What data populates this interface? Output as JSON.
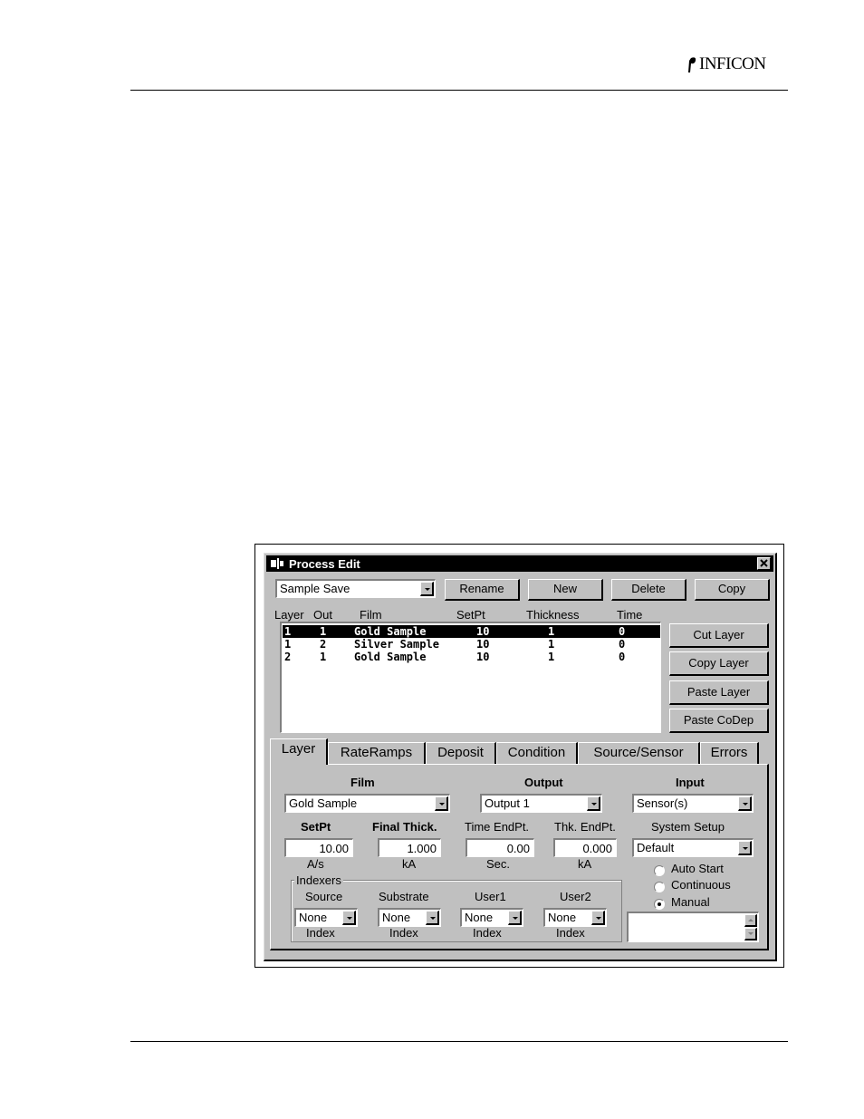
{
  "brand": {
    "logo_text": "INFICON"
  },
  "window": {
    "title": "Process Edit",
    "process_combo": {
      "value": "Sample Save"
    },
    "toolbar": {
      "rename_label": "Rename",
      "new_label": "New",
      "delete_label": "Delete",
      "copy_label": "Copy"
    },
    "list": {
      "columns": [
        "Layer",
        "Out",
        "Film",
        "SetPt",
        "Thickness",
        "Time"
      ],
      "rows": [
        {
          "layer": "1",
          "out": "1",
          "film": "Gold Sample",
          "setpt": "10",
          "thickness": "1",
          "time": "0",
          "selected": true
        },
        {
          "layer": "1",
          "out": "2",
          "film": "Silver Sample",
          "setpt": "10",
          "thickness": "1",
          "time": "0",
          "selected": false
        },
        {
          "layer": "2",
          "out": "1",
          "film": "Gold Sample",
          "setpt": "10",
          "thickness": "1",
          "time": "0",
          "selected": false
        }
      ]
    },
    "side_buttons": {
      "cut": "Cut Layer",
      "copy": "Copy Layer",
      "paste": "Paste Layer",
      "paste_codep": "Paste CoDep"
    },
    "tabs": [
      "Layer",
      "RateRamps",
      "Deposit",
      "Condition",
      "Source/Sensor",
      "Errors"
    ],
    "active_tab": "Layer",
    "layer_tab": {
      "film_label": "Film",
      "film_value": "Gold Sample",
      "output_label": "Output",
      "output_value": "Output 1",
      "input_label": "Input",
      "input_value": "Sensor(s)",
      "setpt_label": "SetPt",
      "setpt_value": "10.00",
      "setpt_unit": "A/s",
      "final_thick_label": "Final Thick.",
      "final_thick_value": "1.000",
      "final_thick_unit": "kA",
      "time_endpt_label": "Time EndPt.",
      "time_endpt_value": "0.00",
      "time_endpt_unit": "Sec.",
      "thk_endpt_label": "Thk. EndPt.",
      "thk_endpt_value": "0.000",
      "thk_endpt_unit": "kA",
      "system_setup_label": "System Setup",
      "system_setup_value": "Default",
      "indexers": {
        "title": "Indexers",
        "items": [
          {
            "label": "Source",
            "value": "None",
            "unit": "Index"
          },
          {
            "label": "Substrate",
            "value": "None",
            "unit": "Index"
          },
          {
            "label": "User1",
            "value": "None",
            "unit": "Index"
          },
          {
            "label": "User2",
            "value": "None",
            "unit": "Index"
          }
        ]
      },
      "start_modes": [
        {
          "label": "Auto Start",
          "selected": false
        },
        {
          "label": "Continuous",
          "selected": false
        },
        {
          "label": "Manual",
          "selected": true
        }
      ]
    }
  }
}
